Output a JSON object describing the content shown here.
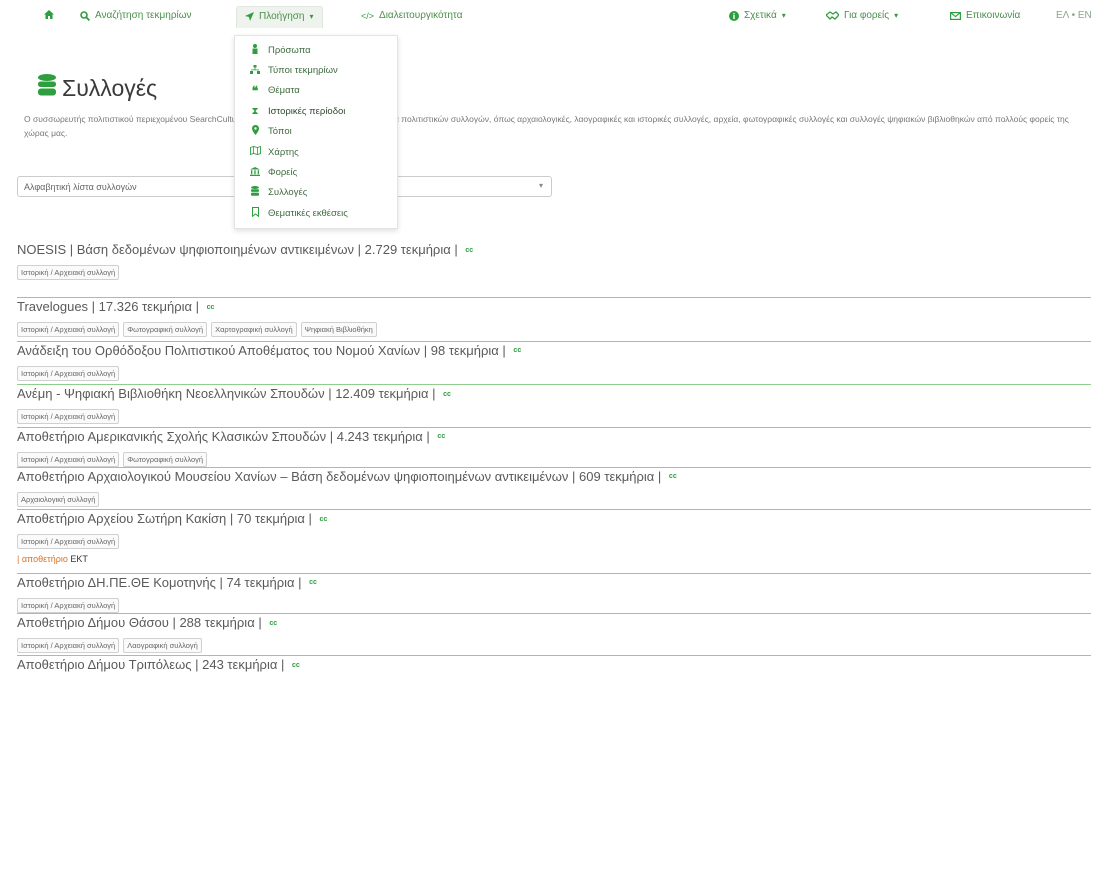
{
  "nav": {
    "home_icon": "home-icon",
    "search_label": "Αναζήτηση τεκμηρίων",
    "browse_label": "Πλοήγηση",
    "interop_label": "Διαλειτουργικότητα",
    "about_label": "Σχετικά",
    "providers_label": "Για φορείς",
    "contact_label": "Επικοινωνία",
    "lang_label": "ΕΛ • EN"
  },
  "dropdown": {
    "items": [
      {
        "label": "Πρόσωπα",
        "icon": "person-icon"
      },
      {
        "label": "Τύποι τεκμηρίων",
        "icon": "sitemap-icon"
      },
      {
        "label": "Θέματα",
        "icon": "quote-icon"
      },
      {
        "label": "Ιστορικές περίοδοι",
        "icon": "hourglass-icon"
      },
      {
        "label": "Τόποι",
        "icon": "map-marker-icon"
      },
      {
        "label": "Χάρτης",
        "icon": "map-icon"
      },
      {
        "label": "Φορείς",
        "icon": "institution-icon"
      },
      {
        "label": "Συλλογές",
        "icon": "database-icon"
      },
      {
        "label": "Θεματικές εκθέσεις",
        "icon": "bookmark-icon"
      }
    ]
  },
  "header": {
    "title": "Συλλογές",
    "description": "Ο συσσωρευτής πολιτιστικού περιεχομένου SearchCulture.gr του ΕΚΤ φιλοξενεί μια μεγάλη ποικιλία πολιτιστικών συλλογών, όπως αρχαιολογικές, λαογραφικές και ιστορικές συλλογές, αρχεία, φωτογραφικές συλλογές και συλλογές ψηφιακών βιβλιοθηκών από πολλούς φορείς της χώρας μας."
  },
  "select": {
    "value": "Αλφαβητική λίστα συλλογών"
  },
  "collections": [
    {
      "name": "NOESIS | Βάση δεδομένων ψηφιοποιημένων αντικειμένων",
      "count": "2.729 τεκμήρια",
      "cc": "cc",
      "tags": [
        "Ιστορική / Αρχειακή συλλογή"
      ]
    },
    {
      "name": "Travelogues",
      "count": "17.326 τεκμήρια",
      "cc": "cc",
      "tags": [
        "Ιστορική / Αρχειακή συλλογή",
        "Φωτογραφική συλλογή",
        "Χαρτογραφική συλλογή",
        "Ψηφιακή Βιβλιοθήκη"
      ]
    },
    {
      "name": "Ανάδειξη του Ορθόδοξου Πολιτιστικού Αποθέματος του Νομού Χανίων",
      "count": "98 τεκμήρια",
      "cc": "cc",
      "tags": [
        "Ιστορική / Αρχειακή συλλογή"
      ]
    },
    {
      "name": "Ανέμη - Ψηφιακή Βιβλιοθήκη Νεοελληνικών Σπουδών",
      "count": "12.409 τεκμήρια",
      "cc": "cc",
      "tags": [
        "Ιστορική / Αρχειακή συλλογή"
      ]
    },
    {
      "name": "Αποθετήριο Αμερικανικής Σχολής Κλασικών Σπουδών",
      "count": "4.243 τεκμήρια",
      "cc": "cc",
      "tags": [
        "Ιστορική / Αρχειακή συλλογή",
        "Φωτογραφική συλλογή"
      ]
    },
    {
      "name": "Αποθετήριο Αρχαιολογικού Μουσείου Χανίων – Βάση δεδομένων ψηφιοποιημένων αντικειμένων",
      "count": "609 τεκμήρια",
      "cc": "cc",
      "tags": [
        "Αρχαιολογική συλλογή"
      ]
    },
    {
      "name": "Αποθετήριο Αρχείου Σωτήρη Κακίση",
      "count": "70 τεκμήρια",
      "cc": "cc",
      "tags": [
        "Ιστορική / Αρχειακή συλλογή"
      ],
      "repo_prefix": "| αποθετήριο",
      "repo_name": "ΕΚΤ"
    },
    {
      "name": "Αποθετήριο ΔΗ.ΠΕ.ΘΕ Κομοτηνής",
      "count": "74 τεκμήρια",
      "cc": "cc",
      "tags": [
        "Ιστορική / Αρχειακή συλλογή"
      ]
    },
    {
      "name": "Αποθετήριο Δήμου Θάσου",
      "count": "288 τεκμήρια",
      "cc": "cc",
      "tags": [
        "Ιστορική / Αρχειακή συλλογή",
        "Λαογραφική συλλογή"
      ]
    },
    {
      "name": "Αποθετήριο Δήμου Τριπόλεως",
      "count": "243 τεκμήρια",
      "cc": "cc",
      "tags": []
    }
  ],
  "colors": {
    "accent": "#2e9e3e",
    "divider": "#8fce8f",
    "repo_prefix": "#e07020"
  }
}
